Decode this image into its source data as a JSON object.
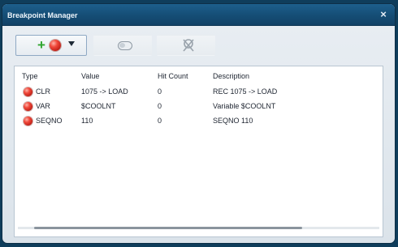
{
  "window": {
    "title": "Breakpoint Manager",
    "close_glyph": "×"
  },
  "toolbar": {
    "add_button": {
      "icon": "plus-icon",
      "glyph": "+",
      "ball_icon": "breakpoint-icon",
      "color": "#2ea52e"
    },
    "toggle_button": {
      "icon": "toggle-icon"
    },
    "delete_button": {
      "icon": "delete-icon"
    }
  },
  "table": {
    "columns": [
      "Type",
      "Value",
      "Hit Count",
      "Description"
    ],
    "rows": [
      {
        "type": "CLR",
        "value": "1075 -> LOAD",
        "hit_count": "0",
        "description": "REC 1075 -> LOAD"
      },
      {
        "type": "VAR",
        "value": "$COOLNT",
        "hit_count": "0",
        "description": "Variable $COOLNT"
      },
      {
        "type": "SEQNO",
        "value": "110",
        "hit_count": "0",
        "description": "SEQNO 110"
      }
    ]
  },
  "colors": {
    "titlebar": "#1d5f8c",
    "breakpoint_red": "#d8291d",
    "add_green": "#2ea52e"
  }
}
